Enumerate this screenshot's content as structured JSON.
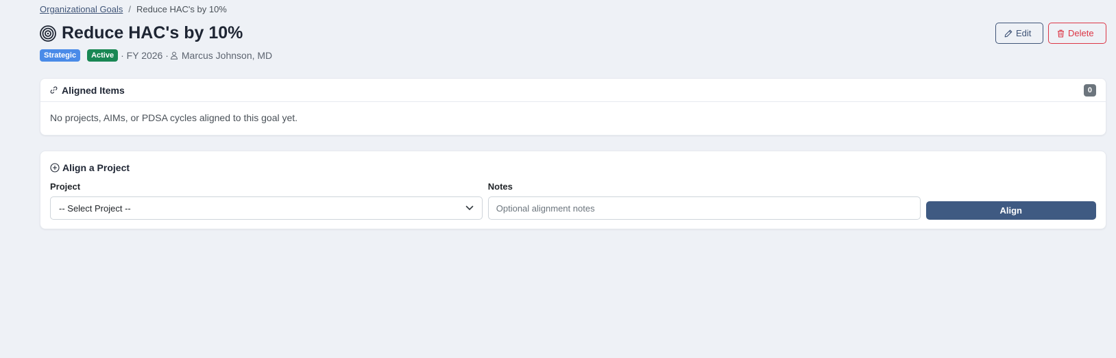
{
  "breadcrumb": {
    "parent_label": "Organizational Goals",
    "separator": "/",
    "current_label": "Reduce HAC's by 10%"
  },
  "header": {
    "title": "Reduce HAC's by 10%",
    "icon": "bullseye-icon",
    "type_badge": "Strategic",
    "status_badge": "Active",
    "fiscal_year": "· FY 2026 ·",
    "owner": "Marcus Johnson, MD"
  },
  "actions": {
    "edit_label": "Edit",
    "delete_label": "Delete"
  },
  "aligned_items": {
    "title": "Aligned Items",
    "count": "0",
    "empty_message": "No projects, AIMs, or PDSA cycles aligned to this goal yet."
  },
  "align_form": {
    "title": "Align a Project",
    "project_label": "Project",
    "project_selected": "-- Select Project --",
    "notes_label": "Notes",
    "notes_placeholder": "Optional alignment notes",
    "submit_label": "Align"
  },
  "colors": {
    "primary": "#3f5a82",
    "strategic_badge": "#4a8be8",
    "active_badge": "#198754",
    "danger": "#dc3545",
    "background": "#eef1f6"
  }
}
